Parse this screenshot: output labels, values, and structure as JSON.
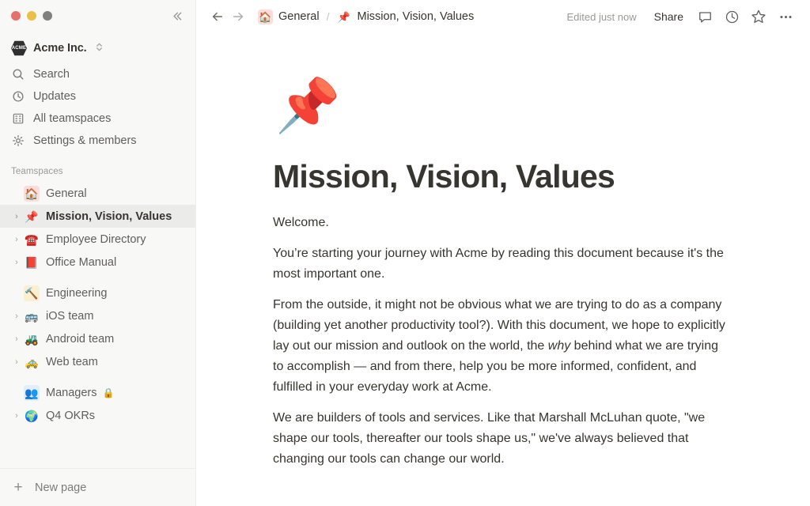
{
  "window": {
    "traffic_lights": [
      "close",
      "minimize",
      "zoom"
    ],
    "collapse_icon": "double-chevron-left-icon",
    "colors": {
      "close": "#E8706A",
      "minimize": "#E9C04A",
      "zoom": "#808080",
      "sidebar_bg": "#F8F8F7",
      "selected_row_bg": "#EBEBEA",
      "text": "#37352F",
      "muted_text": "#9B9A97"
    }
  },
  "sidebar": {
    "workspace": {
      "logo_text": "ACME",
      "name": "Acme Inc.",
      "caret_icon": "chevron-up-down-icon"
    },
    "nav": [
      {
        "label": "Search",
        "icon": "search-icon"
      },
      {
        "label": "Updates",
        "icon": "clock-icon"
      },
      {
        "label": "All teamspaces",
        "icon": "building-icon"
      },
      {
        "label": "Settings & members",
        "icon": "gear-icon"
      }
    ],
    "section_title": "Teamspaces",
    "tree": [
      {
        "label": "General",
        "emoji": "🏠",
        "twisty": false,
        "selected": false,
        "boxed": "house-bg",
        "locked": false
      },
      {
        "label": "Mission, Vision, Values",
        "emoji": "📌",
        "twisty": true,
        "selected": true,
        "boxed": "",
        "locked": false
      },
      {
        "label": "Employee Directory",
        "emoji": "☎️",
        "twisty": true,
        "selected": false,
        "boxed": "",
        "locked": false
      },
      {
        "label": "Office Manual",
        "emoji": "📕",
        "twisty": true,
        "selected": false,
        "boxed": "",
        "locked": false
      }
    ],
    "tree2": [
      {
        "label": "Engineering",
        "emoji": "🔨",
        "twisty": false,
        "selected": false,
        "boxed": "hammer-bg",
        "locked": false
      },
      {
        "label": "iOS team",
        "emoji": "🚌",
        "twisty": true,
        "selected": false,
        "boxed": "",
        "locked": false
      },
      {
        "label": "Android team",
        "emoji": "🚜",
        "twisty": true,
        "selected": false,
        "boxed": "",
        "locked": false
      },
      {
        "label": "Web team",
        "emoji": "🚕",
        "twisty": true,
        "selected": false,
        "boxed": "",
        "locked": false
      }
    ],
    "tree3": [
      {
        "label": "Managers",
        "emoji": "👥",
        "twisty": false,
        "selected": false,
        "boxed": "people-bg",
        "locked": true,
        "lock_icon": "🔒"
      },
      {
        "label": "Q4 OKRs",
        "emoji": "🌍",
        "twisty": true,
        "selected": false,
        "boxed": "",
        "locked": false
      }
    ],
    "new_page": {
      "label": "New page",
      "icon": "plus-icon"
    }
  },
  "topbar": {
    "back_icon": "arrow-left-icon",
    "forward_icon": "arrow-right-icon",
    "breadcrumb": [
      {
        "label": "General",
        "emoji": "🏠",
        "boxed": "house-bg"
      },
      {
        "label": "Mission, Vision, Values",
        "emoji": "📌",
        "boxed": ""
      }
    ],
    "separator": "/",
    "edited_status": "Edited just now",
    "share_label": "Share",
    "actions": [
      {
        "icon": "comment-icon"
      },
      {
        "icon": "history-clock-icon"
      },
      {
        "icon": "star-icon"
      },
      {
        "icon": "more-horizontal-icon"
      }
    ]
  },
  "document": {
    "page_emoji": "📌",
    "title": "Mission, Vision, Values",
    "paragraphs": [
      "Welcome.",
      "You’re starting your journey with Acme by reading this document because it's the most important one.",
      "From the outside, it might not be obvious what we are trying to do as a company (building yet another productivity tool?). With this document, we hope to explicitly lay out our mission and outlook on the world, the ",
      "We are builders of tools and services. Like that Marshall McLuhan quote, \"we shape our tools, thereafter our tools shape us,\" we've always believed that changing our tools can change our world."
    ],
    "para3_italic": "why",
    "para3_tail": " behind what we are trying to accomplish — and from there, help you be more informed, confident, and fulfilled in your everyday work at Acme."
  }
}
